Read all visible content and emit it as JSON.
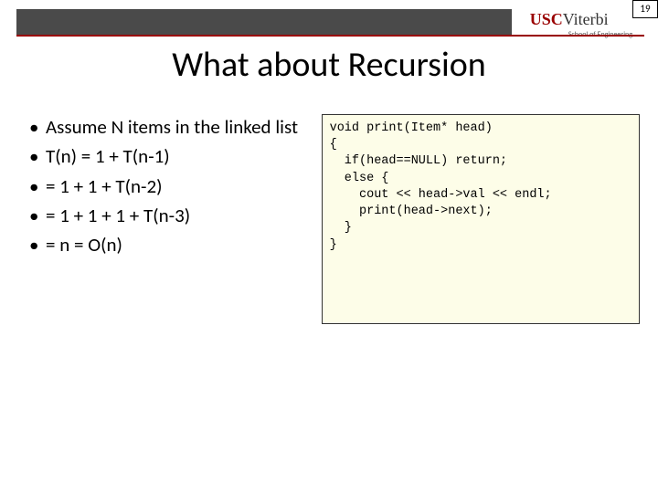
{
  "page_number": "19",
  "logo": {
    "usc": "USC",
    "viterbi": "Viterbi",
    "subtitle": "School of Engineering"
  },
  "title": "What about Recursion",
  "bullets": [
    "Assume N items in the linked list",
    "T(n) = 1 + T(n-1)",
    "= 1 + 1 + T(n-2)",
    "= 1 + 1 + 1 + T(n-3)",
    "= n = O(n)"
  ],
  "code": "void print(Item* head)\n{\n  if(head==NULL) return;\n  else {\n    cout << head->val << endl;\n    print(head->next);\n  }\n}"
}
